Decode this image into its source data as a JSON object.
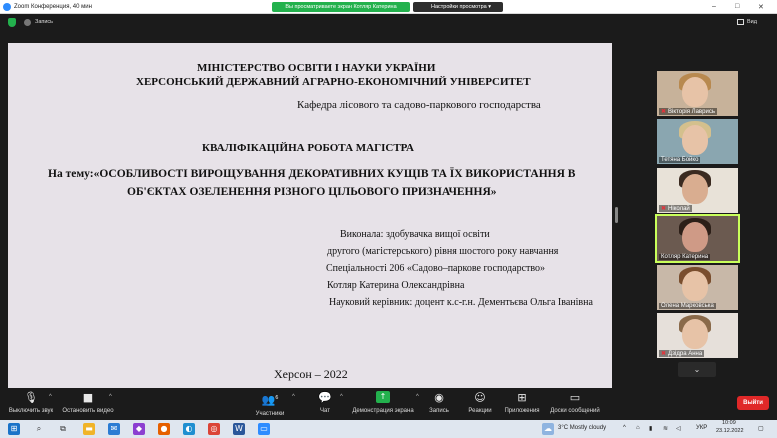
{
  "window": {
    "title": "Zoom Конференция, 40 мин",
    "share_banner": "Вы просматриваете экран Котляр Катерина",
    "view_options": "Настройки просмотра"
  },
  "topbar": {
    "record_label": "Запись",
    "view_label": "Вид"
  },
  "slide": {
    "ministry": "МІНІСТЕРСТВО ОСВІТИ І НАУКИ УКРАЇНИ",
    "university": "ХЕРСОНСЬКИЙ ДЕРЖАВНИЙ АГРАРНО-ЕКОНОМІЧНИЙ УНІВЕРСИТЕТ",
    "department": "Кафедра лісового та садово-паркового господарства",
    "work_type": "КВАЛІФІКАЦІЙНА РОБОТА МАГІСТРА",
    "topic_line1": "На тему:«ОСОБЛИВОСТІ ВИРОЩУВАННЯ ДЕКОРАТИВНИХ КУЩІВ ТА ЇХ ВИКОРИСТАННЯ В",
    "topic_line2": "ОБ'ЄКТАХ ОЗЕЛЕНЕННЯ РІЗНОГО ЦІЛЬОВОГО ПРИЗНАЧЕННЯ»",
    "author_lines": [
      "Виконала: здобувачка вищої освіти",
      "другого (магістерського) рівня шостого року навчання",
      "Спеціальності 206 «Садово–паркове господарство»",
      "Котляр Катерина Олександрівна",
      "Науковий керівник: доцент к.с-г.н. Дементьєва Ольга Іванівна"
    ],
    "city_year": "Херсон – 2022"
  },
  "participants": [
    {
      "name": "Вікторія Лаврись",
      "muted": true
    },
    {
      "name": "Тетяна Бойко",
      "muted": false
    },
    {
      "name": "Ніколай",
      "muted": true
    },
    {
      "name": "Котляр Катерина",
      "muted": false
    },
    {
      "name": "Олена Марковська",
      "muted": false
    },
    {
      "name": "Дзідра Анна",
      "muted": true
    }
  ],
  "toolbar": {
    "mute": "Выключить звук",
    "video": "Остановить видео",
    "participants": "Участники",
    "participants_count": "6",
    "chat": "Чат",
    "share": "Демонстрация экрана",
    "record": "Запись",
    "reactions": "Реакции",
    "apps": "Приложения",
    "whiteboards": "Доски сообщений",
    "leave": "Выйти"
  },
  "taskbar": {
    "weather": "3°C  Mostly cloudy",
    "language": "УКР",
    "time": "10:09",
    "date": "23.12.2022"
  },
  "colors": {
    "accent_green": "#23b14d",
    "leave_red": "#e02828",
    "slide_bg": "#e7e2e8",
    "active_speaker": "#c9ff5a"
  }
}
